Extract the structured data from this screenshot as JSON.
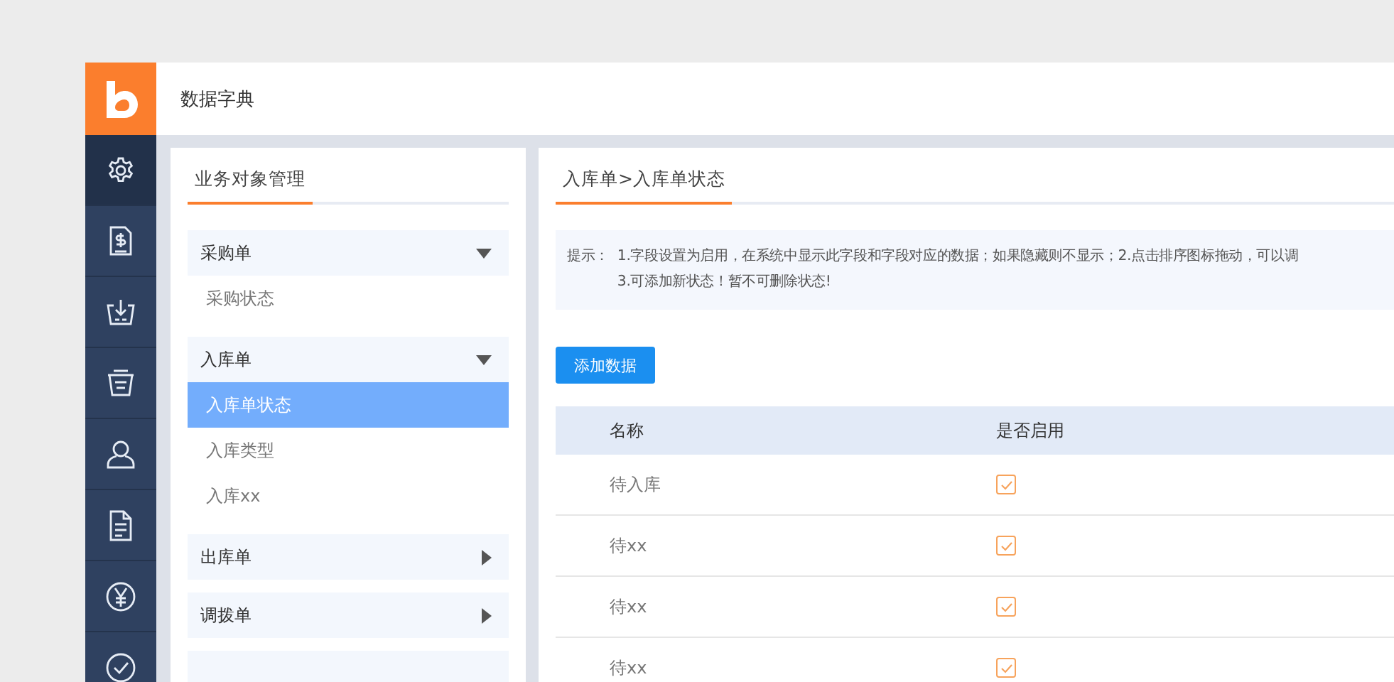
{
  "app": {
    "title": "数据字典"
  },
  "nav": [
    {
      "kind": "gear",
      "selected": true
    },
    {
      "kind": "bill",
      "selected": false
    },
    {
      "kind": "inbox",
      "selected": false
    },
    {
      "kind": "basket",
      "selected": false
    },
    {
      "kind": "user",
      "selected": false
    },
    {
      "kind": "document",
      "selected": false
    },
    {
      "kind": "yen",
      "selected": false
    },
    {
      "kind": "check",
      "selected": false
    }
  ],
  "left_panel": {
    "title": "业务对象管理",
    "groups": [
      {
        "label": "采购单",
        "expanded": true,
        "items": [
          {
            "label": "采购状态",
            "selected": false
          }
        ]
      },
      {
        "label": "入库单",
        "expanded": true,
        "items": [
          {
            "label": "入库单状态",
            "selected": true
          },
          {
            "label": "入库类型",
            "selected": false
          },
          {
            "label": "入库xx",
            "selected": false
          }
        ]
      },
      {
        "label": "出库单",
        "expanded": false
      },
      {
        "label": "调拨单",
        "expanded": false
      }
    ]
  },
  "right_panel": {
    "breadcrumb": "入库单>入库单状态",
    "hint": {
      "label": "提示：",
      "lines": [
        "1.字段设置为启用，在系统中显示此字段和字段对应的数据；如果隐藏则不显示；2.点击排序图标拖动，可以调",
        "3.可添加新状态！暂不可删除状态!"
      ]
    },
    "add_button": "添加数据",
    "table": {
      "columns": [
        "名称",
        "是否启用"
      ],
      "rows": [
        {
          "name": "待入库",
          "enabled": true
        },
        {
          "name": "待xx",
          "enabled": true
        },
        {
          "name": "待xx",
          "enabled": true
        },
        {
          "name": "待xx",
          "enabled": true
        }
      ]
    }
  }
}
